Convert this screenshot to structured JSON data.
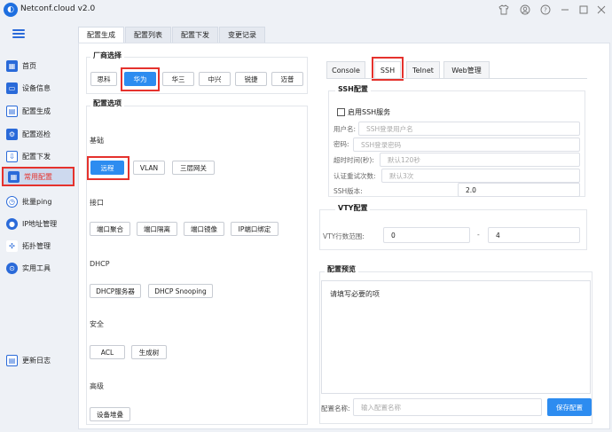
{
  "app": {
    "title": "Netconf.cloud v2.0",
    "logo_glyph": "◐"
  },
  "window_icons": [
    "shirt-icon",
    "user-icon",
    "help-icon",
    "minimize-icon",
    "maximize-icon",
    "close-icon"
  ],
  "sidebar": {
    "items": [
      {
        "label": "首页",
        "icon": "home-icon",
        "color": "#2a6ad9"
      },
      {
        "label": "设备信息",
        "icon": "device-info-icon",
        "color": "#2a6ad9"
      },
      {
        "label": "配置生成",
        "icon": "config-generate-icon",
        "color": "#2a6ad9"
      },
      {
        "label": "配置巡检",
        "icon": "config-inspect-icon",
        "color": "#2a6ad9"
      },
      {
        "label": "配置下发",
        "icon": "config-deploy-icon",
        "color": "#2a6ad9"
      },
      {
        "label": "常用配置",
        "icon": "common-config-icon",
        "color": "#2a6ad9"
      },
      {
        "label": "批量ping",
        "icon": "ping-icon",
        "color": "#2a6ad9"
      },
      {
        "label": "IP地址管理",
        "icon": "ip-icon",
        "color": "#2a6ad9"
      },
      {
        "label": "拓扑管理",
        "icon": "topology-icon",
        "color": "#2a6ad9"
      },
      {
        "label": "实用工具",
        "icon": "tools-icon",
        "color": "#2a6ad9"
      }
    ],
    "changelog_label": "更新日志"
  },
  "top_tabs": [
    "配置生成",
    "配置列表",
    "配置下发",
    "变更记录"
  ],
  "vendor": {
    "legend": "厂商选择",
    "buttons": [
      "思科",
      "华为",
      "华三",
      "中兴",
      "锐捷",
      "迈普"
    ],
    "selected": "华为"
  },
  "options": {
    "legend": "配置选项",
    "groups": [
      {
        "title": "基础",
        "buttons": [
          "远程",
          "VLAN",
          "三层网关"
        ]
      },
      {
        "title": "接口",
        "buttons": [
          "端口聚合",
          "端口隔离",
          "端口镜像",
          "IP端口绑定"
        ]
      },
      {
        "title": "DHCP",
        "buttons": [
          "DHCP服务器",
          "DHCP Snooping"
        ]
      },
      {
        "title": "安全",
        "buttons": [
          "ACL",
          "生成树"
        ]
      },
      {
        "title": "高级",
        "buttons": [
          "设备堆叠"
        ]
      }
    ]
  },
  "sub_tabs": [
    "Console",
    "SSH",
    "Telnet",
    "Web管理"
  ],
  "ssh": {
    "legend": "SSH配置",
    "enable_label": "启用SSH服务",
    "username_label": "用户名:",
    "username_placeholder": "SSH登录用户名",
    "password_label": "密码:",
    "password_placeholder": "SSH登录密码",
    "timeout_label": "超时时间(秒):",
    "timeout_placeholder": "默认120秒",
    "retry_label": "认证重试次数:",
    "retry_placeholder": "默认3次",
    "version_label": "SSH版本:",
    "version_value": "2.0"
  },
  "vty": {
    "legend": "VTY配置",
    "range_label": "VTY行数范围:",
    "from": "0",
    "separator": "-",
    "to": "4"
  },
  "preview": {
    "legend": "配置预览",
    "text": "请填写必要的项"
  },
  "config_name": {
    "label": "配置名称:",
    "placeholder": "输入配置名称",
    "save_label": "保存配置"
  },
  "colors": {
    "accent": "#2d8cf0",
    "highlight": "#e5322d",
    "nav_blue": "#2a6ad9"
  }
}
